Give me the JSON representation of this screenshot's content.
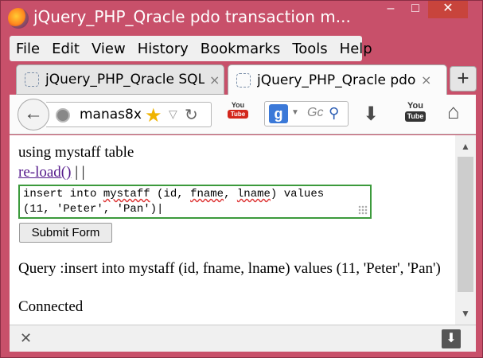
{
  "window": {
    "title": "jQuery_PHP_Qracle pdo transaction m...",
    "minimize": "–",
    "maximize": "□",
    "close": "✕"
  },
  "menu": [
    "File",
    "Edit",
    "View",
    "History",
    "Bookmarks",
    "Tools",
    "Help"
  ],
  "tabs": [
    {
      "label": "jQuery_PHP_Qracle SQL...",
      "close": "×",
      "active": false
    },
    {
      "label": "jQuery_PHP_Qracle pdo...",
      "close": "×",
      "active": true
    }
  ],
  "newtab": "+",
  "navbar": {
    "url": "manas8x",
    "search_text": "Gc",
    "search_engine": "g",
    "youtube_small_top": "You",
    "youtube_small_bottom": "Tube",
    "youtube_big_top": "You",
    "youtube_big_bottom": "Tube"
  },
  "content": {
    "heading": "using mystaff table",
    "reload_link": "re-load()",
    "separator": " | |",
    "sql_line1_pre": "insert into ",
    "sql_line1_table": "mystaff",
    "sql_line1_mid": " (id, ",
    "sql_line1_fname": "fname",
    "sql_line1_sep": ", ",
    "sql_line1_lname": "lname",
    "sql_line1_post": ") values",
    "sql_line2": "(11, 'Peter', 'Pan')",
    "submit_label": "Submit Form",
    "query_text": "Query :insert into mystaff (id, fname, lname) values (11, 'Peter', 'Pan')",
    "connected_text": "Connected"
  },
  "colors": {
    "frame": "#c8506a",
    "sql_border": "#3c9a3c",
    "link": "#551a8b"
  }
}
